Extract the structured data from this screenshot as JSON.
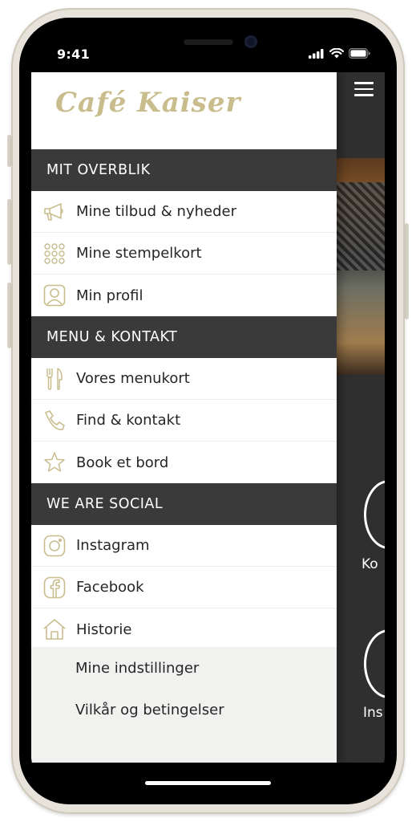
{
  "status_bar": {
    "time": "9:41"
  },
  "brand": {
    "logo_text": "Café Kaiser",
    "accent_color": "#c9bd8e"
  },
  "drawer": {
    "sections": [
      {
        "title": "MIT OVERBLIK",
        "items": [
          {
            "label": "Mine tilbud & nyheder",
            "icon": "megaphone-icon"
          },
          {
            "label": "Mine stempelkort",
            "icon": "stamp-grid-icon"
          },
          {
            "label": "Min profil",
            "icon": "user-profile-icon"
          }
        ]
      },
      {
        "title": "MENU & KONTAKT",
        "items": [
          {
            "label": "Vores menukort",
            "icon": "fork-knife-icon"
          },
          {
            "label": "Find & kontakt",
            "icon": "phone-icon"
          },
          {
            "label": "Book et bord",
            "icon": "star-icon"
          }
        ]
      },
      {
        "title": "WE ARE SOCIAL",
        "items": [
          {
            "label": "Instagram",
            "icon": "instagram-icon"
          },
          {
            "label": "Facebook",
            "icon": "facebook-icon"
          },
          {
            "label": "Historie",
            "icon": "home-icon"
          }
        ]
      }
    ],
    "settings": [
      {
        "label": "Mine indstillinger"
      },
      {
        "label": "Vilkår og betingelser"
      }
    ]
  },
  "background_screen": {
    "labels": [
      "Ko",
      "Ins"
    ]
  }
}
